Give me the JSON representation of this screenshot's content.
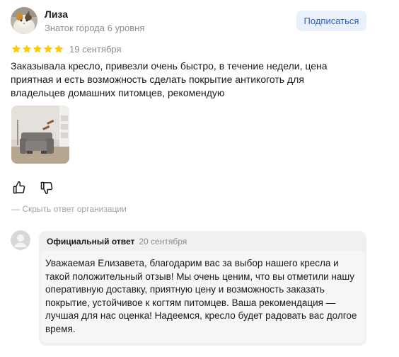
{
  "review": {
    "author_name": "Лиза",
    "author_level": "Знаток города 6 уровня",
    "subscribe_label": "Подписаться",
    "rating": 5,
    "rating_max": 5,
    "date": "19 сентября",
    "text": "Заказывала кресло, привезли очень быстро, в течение недели, цена приятная и есть возможность сделать покрытие антикоготь для владельцев домашних питомцев, рекомендую",
    "photo_count": 1
  },
  "actions": {
    "like_icon": "thumbs-up-icon",
    "dislike_icon": "thumbs-down-icon",
    "hide_answer_label": "— Скрыть ответ организации"
  },
  "org_answer": {
    "title": "Официальный ответ",
    "date": "20 сентября",
    "text": "Уважаемая Елизавета, благодарим вас за выбор нашего кресла и такой положительный отзыв! Мы очень ценим, что вы отметили нашу оперативную доставку, приятную цену и возможность заказать покрытие, устойчивое к когтям питомцев. Ваша рекомендация — лучшая для нас оценка! Надеемся, кресло будет радовать вас долгое время."
  },
  "colors": {
    "star": "#ffcc00",
    "subscribe_bg": "#eaf1fd",
    "subscribe_text": "#2362c6",
    "answer_bg": "#f0f0f0",
    "muted_text": "#8c8c8c"
  }
}
